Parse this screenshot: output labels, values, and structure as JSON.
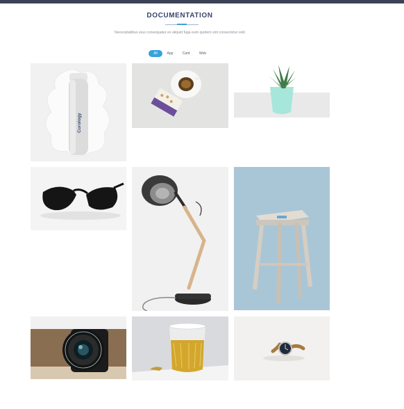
{
  "header": {
    "title": "DOCUMENTATION",
    "subtitle": "Necessitatibus eius consequatur ex aliquid fuga eum quidem sint consectetur velit",
    "accent_color": "#37a3dc"
  },
  "filters": {
    "items": [
      {
        "label": "All",
        "active": true
      },
      {
        "label": "App",
        "active": false
      },
      {
        "label": "Card",
        "active": false
      },
      {
        "label": "Web",
        "active": false
      }
    ]
  },
  "portfolio": {
    "items": [
      {
        "subject": "cosmetic-bottle",
        "brand_text": "Curology"
      },
      {
        "subject": "coffee-cup"
      },
      {
        "subject": "potted-succulent"
      },
      {
        "subject": "sunglasses"
      },
      {
        "subject": "desk-lamp"
      },
      {
        "subject": "wooden-stool"
      },
      {
        "subject": "camera-lens"
      },
      {
        "subject": "glass-of-drink"
      },
      {
        "subject": "wrist-watch"
      }
    ]
  }
}
